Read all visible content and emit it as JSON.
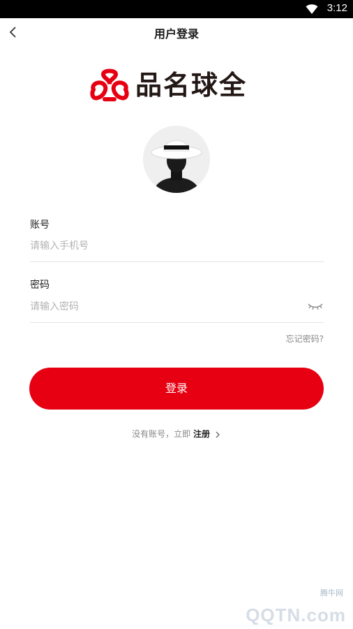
{
  "status_bar": {
    "time": "3:12",
    "icons": [
      "wifi-icon"
    ]
  },
  "header": {
    "title": "用户登录",
    "back_icon": "chevron-left-icon"
  },
  "logo": {
    "text": "品名球全",
    "brand_color": "#e60012"
  },
  "form": {
    "account": {
      "label": "账号",
      "placeholder": "请输入手机号",
      "value": ""
    },
    "password": {
      "label": "密码",
      "placeholder": "请输入密码",
      "value": "",
      "visibility_icon": "eye-closed-icon"
    },
    "forgot_label": "忘记密码?"
  },
  "login_button": {
    "label": "登录",
    "color": "#e60012"
  },
  "register": {
    "prompt": "没有账号，立即",
    "link_label": "注册"
  },
  "watermark": {
    "top": "腾牛网",
    "main": "QQTN.com"
  }
}
